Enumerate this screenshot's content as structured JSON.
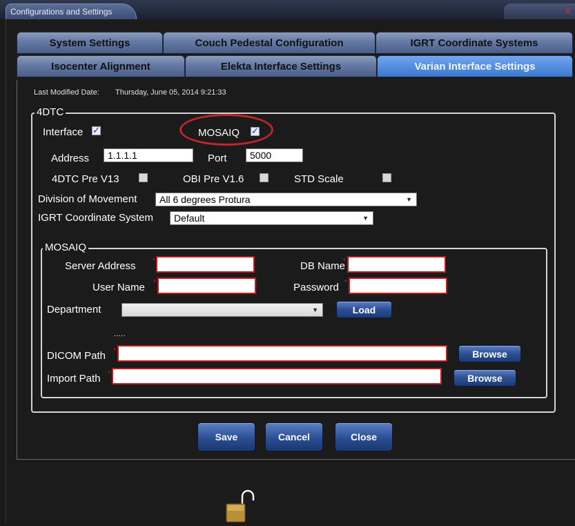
{
  "window": {
    "title": "Configurations and Settings",
    "close_glyph": "X"
  },
  "tabs_row1": [
    {
      "label": "System Settings"
    },
    {
      "label": "Couch Pedestal Configuration"
    },
    {
      "label": "IGRT Coordinate Systems"
    }
  ],
  "tabs_row2": [
    {
      "label": "Isocenter Alignment"
    },
    {
      "label": "Elekta Interface Settings"
    },
    {
      "label": "Varian Interface Settings"
    }
  ],
  "active_tab": "Varian Interface Settings",
  "last_modified": {
    "label": "Last Modified Date:",
    "value": "Thursday, June 05, 2014 9:21:33"
  },
  "fourdtc": {
    "legend": "4DTC",
    "interface_label": "Interface",
    "interface_checked": true,
    "mosaiq_label": "MOSAIQ",
    "mosaiq_checked": true,
    "address_label": "Address",
    "address_value": "1.1.1.1",
    "port_label": "Port",
    "port_value": "5000",
    "pre_v13_label": "4DTC Pre V13",
    "obi_label": "OBI Pre V1.6",
    "std_label": "STD Scale",
    "division_label": "Division of Movement",
    "division_value": "All 6 degrees Protura",
    "igrt_label": "IGRT Coordinate System",
    "igrt_value": "Default"
  },
  "mosaiq": {
    "legend": "MOSAIQ",
    "server_label": "Server Address",
    "db_label": "DB Name",
    "user_label": "User Name",
    "password_label": "Password",
    "department_label": "Department",
    "department_value": "",
    "load_label": "Load",
    "ellipsis": ".....",
    "dicom_label": "DICOM Path",
    "import_label": "Import Path",
    "browse_label": "Browse",
    "required_mark": "*"
  },
  "actions": {
    "save": "Save",
    "cancel": "Cancel",
    "close": "Close"
  },
  "colors": {
    "active_tab": "#3b78cf",
    "required_border": "#c21b1b",
    "highlight_ring": "#c0262b"
  },
  "icons": {
    "lock": "unlocked-padlock-icon"
  }
}
